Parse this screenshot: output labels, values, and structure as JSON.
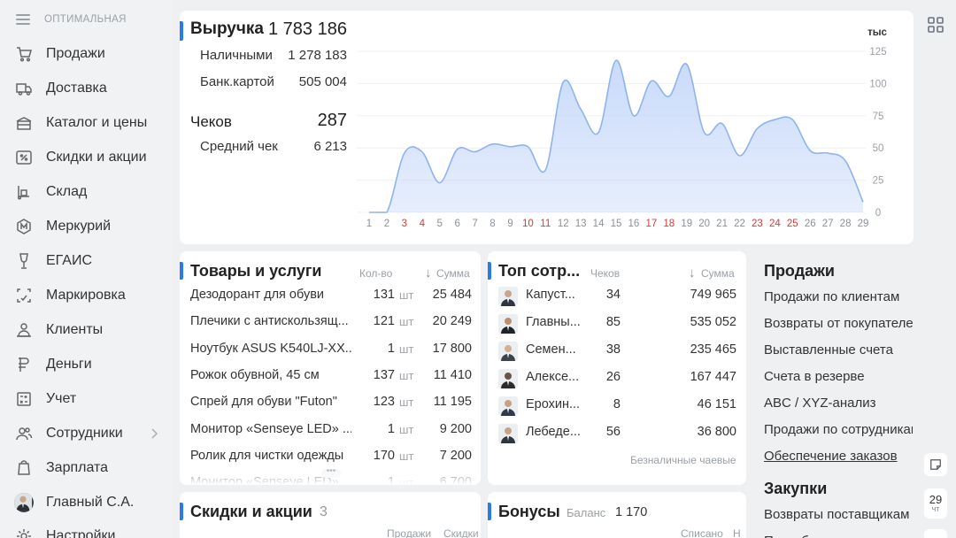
{
  "sidebar": {
    "mode_label": "ОПТИМАЛЬНАЯ",
    "items": [
      {
        "label": "Продажи",
        "icon": "cart-icon"
      },
      {
        "label": "Доставка",
        "icon": "truck-icon"
      },
      {
        "label": "Каталог и цены",
        "icon": "catalog-icon"
      },
      {
        "label": "Скидки и акции",
        "icon": "percent-icon"
      },
      {
        "label": "Склад",
        "icon": "warehouse-icon"
      },
      {
        "label": "Меркурий",
        "icon": "mercury-icon"
      },
      {
        "label": "ЕГАИС",
        "icon": "wine-glass-icon"
      },
      {
        "label": "Маркировка",
        "icon": "barcode-icon"
      },
      {
        "label": "Клиенты",
        "icon": "clients-icon"
      },
      {
        "label": "Деньги",
        "icon": "money-icon"
      },
      {
        "label": "Учет",
        "icon": "accounting-icon"
      },
      {
        "label": "Сотрудники",
        "icon": "employees-icon"
      },
      {
        "label": "Зарплата",
        "icon": "salary-icon"
      },
      {
        "label": "Главный С.А.",
        "icon": "user-avatar"
      },
      {
        "label": "Настройки",
        "icon": "gear-icon"
      }
    ]
  },
  "revenue": {
    "title": "Выручка",
    "total": "1 783 186",
    "cash_label": "Наличными",
    "cash_value": "1 278 183",
    "card_label": "Банк.картой",
    "card_value": "505 004",
    "checks_label": "Чеков",
    "checks_value": "287",
    "avg_label": "Средний чек",
    "avg_value": "6 213"
  },
  "chart_data": {
    "type": "area",
    "ylabel": "тыс",
    "ylim": [
      0,
      125
    ],
    "yticks": [
      "125",
      "100",
      "75",
      "50",
      "25",
      "0"
    ],
    "x": [
      "1",
      "2",
      "3",
      "4",
      "5",
      "6",
      "7",
      "8",
      "9",
      "10",
      "11",
      "12",
      "13",
      "14",
      "15",
      "16",
      "17",
      "18",
      "19",
      "20",
      "21",
      "22",
      "23",
      "24",
      "25",
      "26",
      "27",
      "28",
      "29"
    ],
    "weekend_days": [
      "3",
      "4",
      "10",
      "11",
      "17",
      "18",
      "23",
      "24",
      "25"
    ],
    "values": [
      0,
      0,
      46,
      47,
      23,
      49,
      47,
      53,
      51,
      51,
      33,
      101,
      80,
      62,
      118,
      75,
      102,
      90,
      115,
      62,
      69,
      44,
      65,
      72,
      72,
      48,
      46,
      40,
      8
    ],
    "colors": {
      "line": "#8fb3ee",
      "fill": "#c9dafa",
      "weekend": "#d23b3b"
    }
  },
  "goods": {
    "title": "Товары и услуги",
    "col_qty": "Кол-во",
    "col_sum": "Сумма",
    "rows": [
      {
        "name": "Дезодорант для обуви",
        "qty": "131",
        "unit": "шт",
        "sum": "25 484"
      },
      {
        "name": "Плечики с антискользящ...",
        "qty": "121",
        "unit": "шт",
        "sum": "20 249"
      },
      {
        "name": "Ноутбук ASUS K540LJ-XX...",
        "qty": "1",
        "unit": "шт",
        "sum": "17 800"
      },
      {
        "name": "Рожок обувной, 45 см",
        "qty": "137",
        "unit": "шт",
        "sum": "11 410"
      },
      {
        "name": "Спрей для обуви \"Futon\"",
        "qty": "123",
        "unit": "шт",
        "sum": "11 195"
      },
      {
        "name": "Монитор «Senseye LED» ...",
        "qty": "1",
        "unit": "шт",
        "sum": "9 200"
      },
      {
        "name": "Ролик для чистки одежды",
        "qty": "170",
        "unit": "шт",
        "sum": "7 200"
      },
      {
        "name": "Монитор «Senseye LED» ...",
        "qty": "1",
        "unit": "шт",
        "sum": "6 700"
      }
    ]
  },
  "staff": {
    "title": "Топ сотр...",
    "col_checks": "Чеков",
    "col_sum": "Сумма",
    "rows": [
      {
        "name": "Капуст...",
        "checks": "34",
        "sum": "749 965"
      },
      {
        "name": "Главны...",
        "checks": "85",
        "sum": "535 052"
      },
      {
        "name": "Семен...",
        "checks": "38",
        "sum": "235 465"
      },
      {
        "name": "Алексе...",
        "checks": "26",
        "sum": "167 447"
      },
      {
        "name": "Ерохин...",
        "checks": "8",
        "sum": "46 151"
      },
      {
        "name": "Лебеде...",
        "checks": "56",
        "sum": "36 800"
      }
    ],
    "footer": "Безналичные чаевые"
  },
  "reports": {
    "sales_title": "Продажи",
    "sales_links": [
      "Продажи по клиентам",
      "Возвраты от покупателей",
      "Выставленные счета",
      "Счета в резерве",
      "ABC / XYZ-анализ",
      "Продажи по сотрудникам",
      "Обеспечение заказов"
    ],
    "purchases_title": "Закупки",
    "purchases_links": [
      "Возвраты поставщикам",
      "Потребность"
    ]
  },
  "discounts": {
    "title": "Скидки и акции",
    "count": "3",
    "col_sales": "Продажи",
    "col_discount": "Скидки"
  },
  "bonuses": {
    "title": "Бонусы",
    "balance_label": "Баланс",
    "balance_value": "1 170",
    "col_written": "Списано",
    "col_more": "Н"
  },
  "date_badge": {
    "day": "29",
    "weekday": "чт"
  }
}
